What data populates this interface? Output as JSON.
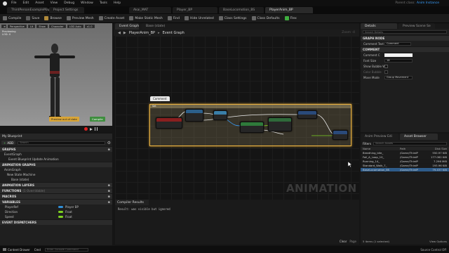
{
  "menu": [
    "File",
    "Edit",
    "Asset",
    "View",
    "Debug",
    "Window",
    "Tools",
    "Help"
  ],
  "window": {
    "parent_class_label": "Parent class:",
    "parent_class": "Anim Instance"
  },
  "project": {
    "name": "ThirdPersonExampleMap",
    "settings": "Project Settings"
  },
  "doc_tabs": [
    "Akai_MAT",
    "Player_BP",
    "BaseLocomotion_BS",
    "PlayerAnim_BP"
  ],
  "toolbar": [
    "Compile",
    "Save",
    "Browse",
    "Preview Mesh",
    "Create Asset",
    "Make Static Mesh",
    "Find",
    "Hide Unrelated",
    "Class Settings",
    "Class Defaults",
    "Flex"
  ],
  "viewport": {
    "buttons": [
      "Perspective",
      "Lit",
      "Show",
      "Character",
      "LOD Auto",
      "x1.0"
    ],
    "caption": "Previewing",
    "lod": "LOD: 0",
    "preview_label": "Preview out of date",
    "compile_label": "Compile"
  },
  "graph": {
    "tab": "Event Graph",
    "breadcrumb_root": "PlayerAnim_BP",
    "breadcrumb_leaf": "Event Graph",
    "zoom": "Zoom -4",
    "comment_tab": "Comment",
    "comment_header": "Set",
    "watermark": "ANIMATION"
  },
  "my_blueprint": {
    "title": "My Blueprint",
    "add_label": "ADD",
    "search_placeholder": "Search",
    "graphs_label": "GRAPHS",
    "event_graph": "EventGraph",
    "event_node": "Event Blueprint Update Animation",
    "anim_graphs_label": "ANIMATION GRAPHS",
    "anim_graph": "AnimGraph",
    "state_machine": "New State Machine",
    "base_state": "Base (state)",
    "anim_layers_label": "ANIMATION LAYERS",
    "functions_label": "FUNCTIONS",
    "functions_count": "(1 Overridable)",
    "macros_label": "MACROS",
    "variables_label": "VARIABLES",
    "event_dispatchers_label": "EVENT DISPATCHERS",
    "variables": [
      {
        "name": "PlayerRef",
        "type": "Player BP",
        "color": "#2f8fd8"
      },
      {
        "name": "Direction",
        "type": "Float",
        "color": "#7ed321"
      },
      {
        "name": "Speed",
        "type": "Float",
        "color": "#7ed321"
      }
    ]
  },
  "compiler": {
    "title": "Compiler Results",
    "message": "Result: was visible but ignored",
    "clear": "Clear",
    "page": "Page"
  },
  "details": {
    "title": "Details",
    "preview_tab": "Preview Scene Se",
    "search_placeholder": "Search Details",
    "graph_node_label": "GRAPH NODE",
    "comment_text_label": "Comment Text",
    "comment_text_value": "Comment",
    "comment_section": "COMMENT",
    "rows": [
      {
        "label": "Comment C",
        "value": ""
      },
      {
        "label": "Font Size",
        "value": "18"
      },
      {
        "label": "Show Bubble W",
        "value": ""
      },
      {
        "label": "Color Bubble",
        "value": ""
      },
      {
        "label": "Move Mode",
        "value": "Group Movement"
      }
    ]
  },
  "asset_browser": {
    "tabs": [
      "Anim Preview Edi",
      "Asset Browser"
    ],
    "filters": "Filters",
    "search_placeholder": "Search Assets",
    "columns": [
      "Name",
      "Path",
      "Disk Size"
    ],
    "assets": [
      {
        "name": "Breathing_Idle_",
        "path": "/Game/ThirdP",
        "size": "550.97 KiB"
      },
      {
        "name": "Fall_A_Loop_10_",
        "path": "/Game/ThirdP",
        "size": "177.062 KiB"
      },
      {
        "name": "Running_14_",
        "path": "/Game/ThirdP",
        "size": "7.296 MiB"
      },
      {
        "name": "Standard_Walk_7_",
        "path": "/Game/ThirdP",
        "size": "193.96 KiB"
      },
      {
        "name": "BaseLocomotion_BS",
        "path": "/Game/ThirdP",
        "size": "79.437 KiB"
      }
    ],
    "status": "5 items (1 selected)",
    "view_options": "View Options"
  },
  "statusbar": {
    "content_drawer": "Content Drawer",
    "cmd": "Cmd",
    "console_placeholder": "Enter Console Command",
    "source_control": "Source Control Off"
  }
}
